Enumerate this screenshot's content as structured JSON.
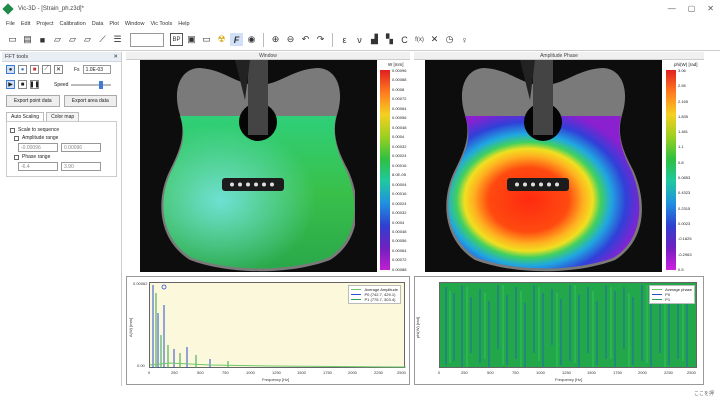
{
  "window": {
    "title": "Vic-3D - [Strain_ph.z3d]*",
    "min": "—",
    "max": "▢",
    "close": "✕"
  },
  "menu": [
    "File",
    "Edit",
    "Project",
    "Calibration",
    "Data",
    "Plot",
    "Window",
    "Vic Tools",
    "Help"
  ],
  "toolbar": {
    "icons": [
      "new-icon",
      "open-icon",
      "save-icon",
      "folder-icon",
      "folder-icon",
      "folder-icon",
      "pipette-icon",
      "list-icon"
    ],
    "field_value": "",
    "icons2": [
      "bp-icon",
      "image-icon",
      "monitor-icon",
      "biohazard-icon",
      "function-icon",
      "eye-icon"
    ],
    "icons3": [
      "zoom-in-icon",
      "zoom-out-icon",
      "undo-icon",
      "redo-icon"
    ],
    "icons4": [
      "epsilon-icon",
      "nu-icon",
      "chart-icon",
      "chart-icon",
      "c-icon",
      "fx-icon",
      "cross-icon",
      "clock-icon",
      "person-icon"
    ],
    "icons4_glyphs": [
      "ε",
      "ν",
      "▟",
      "▚",
      "C",
      "f(x)",
      "✕",
      "◷",
      "♀"
    ]
  },
  "left_panel": {
    "title": "FFT tools",
    "fs_label": "Fs",
    "fs_value": "1.0E-03",
    "speed_label": "Speed",
    "export_point": "Export point data",
    "export_area": "Export area data",
    "tabs": [
      "Auto Scaling",
      "Color map"
    ],
    "scale_to_sequence": "Scale to sequence",
    "amplitude_range": "Amplitude range",
    "amp_min": "-0.00096",
    "amp_max": "0.00096",
    "phase_range": "Phase range",
    "phase_min": "-6.4",
    "phase_max": "3.90"
  },
  "views": {
    "magnitude_title": "Window",
    "phase_title": "Amplitude Phase",
    "mag_unit": "W [mm]",
    "phase_unit": "phi(W) [rad]",
    "mag_ticks": [
      "0.00096",
      "0.00088",
      "0.0008",
      "0.00072",
      "0.00064",
      "0.00056",
      "0.00048",
      "0.0004",
      "0.00032",
      "0.00024",
      "0.00016",
      "8.0E-05",
      "0.00004",
      "0.00016",
      "0.00024",
      "0.00032",
      "0.0004",
      "0.00048",
      "0.00056",
      "0.00064",
      "0.00072",
      "0.00088"
    ],
    "phase_ticks": [
      "3.06",
      "2.55",
      "2.165",
      "1.835",
      "1.481",
      "1.1",
      "0.8",
      "0.0853",
      "0.4323",
      "0.2315",
      "0.0023",
      "-0.1825",
      "-0.2963",
      "0.5"
    ]
  },
  "plot_left": {
    "ylabel": "A(W) [mm]",
    "xlabel": "Frequency [Hz]",
    "y_ticks": [
      "0.00062",
      "0.00"
    ],
    "x_ticks": [
      "0",
      "250",
      "500",
      "750",
      "1000",
      "1250",
      "1500",
      "1750",
      "2000",
      "2250",
      "2500"
    ],
    "legend": [
      {
        "name": "Average Amplitude",
        "color": "#6cc96c"
      },
      {
        "name": "P0 (742.7, 429.1)",
        "color": "#2a4fcf"
      },
      {
        "name": "P1 (775.7, 303.4)",
        "color": "#30a14e"
      }
    ]
  },
  "plot_right": {
    "ylabel": "phi(W) [rad]",
    "xlabel": "Frequency [Hz]",
    "x_ticks": [
      "0",
      "250",
      "500",
      "750",
      "1000",
      "1250",
      "1500",
      "1750",
      "2000",
      "2250",
      "2500"
    ],
    "legend": [
      {
        "name": "Average phase",
        "color": "#6cc96c"
      },
      {
        "name": "P0",
        "color": "#2a4fcf"
      },
      {
        "name": "P1",
        "color": "#30a14e"
      }
    ]
  },
  "status": {
    "text": "ここを押 "
  },
  "colors": {
    "accent": "#3d7bd9",
    "plot_bg": "#fbf8dc",
    "green": "#26c26b",
    "blue": "#2a4fcf"
  }
}
